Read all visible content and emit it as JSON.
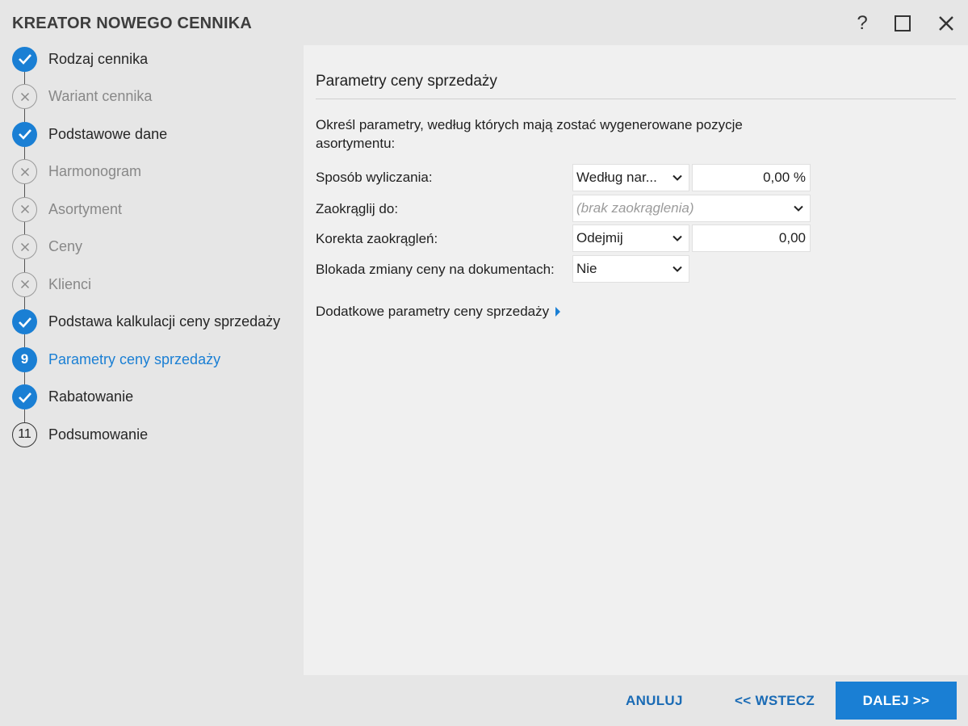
{
  "window": {
    "title": "KREATOR NOWEGO CENNIKA",
    "help_label": "?"
  },
  "steps": [
    {
      "label": "Rodzaj cennika",
      "state": "done"
    },
    {
      "label": "Wariant cennika",
      "state": "skip"
    },
    {
      "label": "Podstawowe dane",
      "state": "done"
    },
    {
      "label": "Harmonogram",
      "state": "skip"
    },
    {
      "label": "Asortyment",
      "state": "skip"
    },
    {
      "label": "Ceny",
      "state": "skip"
    },
    {
      "label": "Klienci",
      "state": "skip"
    },
    {
      "label": "Podstawa kalkulacji ceny sprzedaży",
      "state": "done"
    },
    {
      "label": "Parametry ceny sprzedaży",
      "state": "current",
      "number": "9"
    },
    {
      "label": "Rabatowanie",
      "state": "done"
    },
    {
      "label": "Podsumowanie",
      "state": "pending",
      "number": "11"
    }
  ],
  "main": {
    "section_title": "Parametry ceny sprzedaży",
    "description": "Określ parametry, według których mają zostać wygenerowane pozycje asortymentu:",
    "fields": {
      "calc_method": {
        "label": "Sposób wyliczania:",
        "select_value": "Według nar...",
        "value": "0,00 %"
      },
      "round_to": {
        "label": "Zaokrąglij do:",
        "placeholder": "(brak zaokrąglenia)"
      },
      "round_correction": {
        "label": "Korekta zaokrągleń:",
        "select_value": "Odejmij",
        "value": "0,00"
      },
      "price_lock": {
        "label": "Blokada zmiany ceny na dokumentach:",
        "select_value": "Nie"
      }
    },
    "more_params_label": "Dodatkowe parametry ceny sprzedaży"
  },
  "footer": {
    "cancel_label": "ANULUJ",
    "back_label": "<< WSTECZ",
    "next_label": "DALEJ >>"
  },
  "colors": {
    "accent": "#1a7fd4",
    "link": "#1a6bb5",
    "sidebar_bg": "#e6e6e6",
    "content_bg": "#f0f0f0"
  }
}
